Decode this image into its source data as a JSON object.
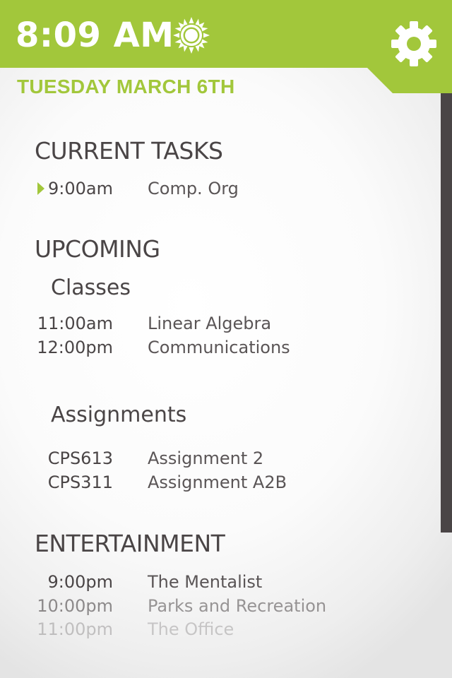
{
  "header": {
    "time": "8:09 AM",
    "weather_icon": "sun-icon",
    "settings_icon": "gear-icon",
    "date": "TUESDAY MARCH 6TH",
    "accent_color": "#a2c73b"
  },
  "current_tasks": {
    "heading": "CURRENT TASKS",
    "items": [
      {
        "time": "9:00am",
        "name": "Comp. Org"
      }
    ]
  },
  "upcoming": {
    "heading": "UPCOMING",
    "classes": {
      "heading": "Classes",
      "items": [
        {
          "time": "11:00am",
          "name": "Linear Algebra"
        },
        {
          "time": "12:00pm",
          "name": "Communications"
        }
      ]
    },
    "assignments": {
      "heading": "Assignments",
      "items": [
        {
          "code": "CPS613",
          "name": "Assignment 2"
        },
        {
          "code": "CPS311",
          "name": "Assignment A2B"
        }
      ]
    }
  },
  "entertainment": {
    "heading": "ENTERTAINMENT",
    "items": [
      {
        "time": "9:00pm",
        "name": "The Mentalist"
      },
      {
        "time": "10:00pm",
        "name": "Parks and Recreation"
      },
      {
        "time": "11:00pm",
        "name": "The Office"
      }
    ]
  }
}
